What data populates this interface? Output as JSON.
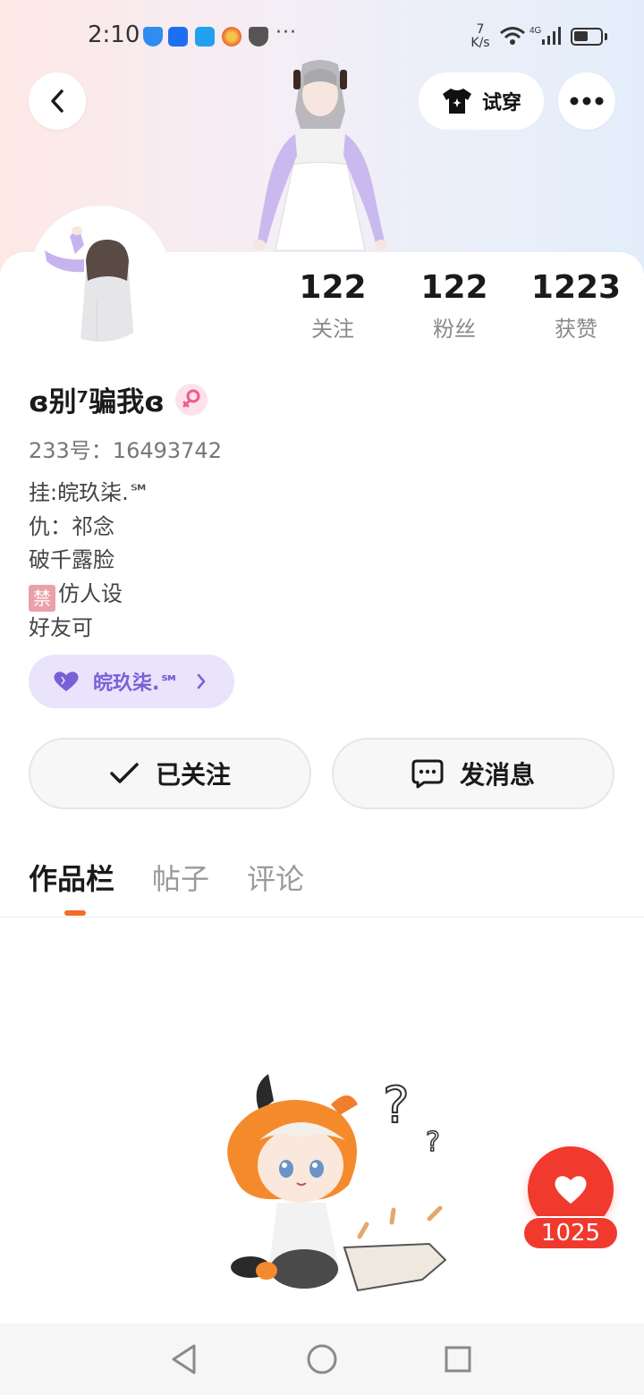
{
  "status_bar": {
    "time": "2:10",
    "more": "···",
    "net_speed_value": "7",
    "net_speed_unit": "K/s",
    "network_type": "4G",
    "battery_level": 0.55
  },
  "header": {
    "tryon_label": "试穿",
    "back_icon": "chevron-left-icon",
    "more_icon": "more-dots-icon",
    "tryon_icon": "tshirt-icon"
  },
  "stats": [
    {
      "value": "122",
      "label": "关注"
    },
    {
      "value": "122",
      "label": "粉丝"
    },
    {
      "value": "1223",
      "label": "获赞"
    }
  ],
  "profile": {
    "username": "ɞ别⁷骗我ɞ",
    "gender": "female",
    "uid": "233号：16493742",
    "bio_lines": [
      "挂:皖玖柒.℠",
      "仇：祁念",
      "破千露脸",
      "仿人设",
      "好友可"
    ],
    "ban_mark": "禁"
  },
  "group_chip": {
    "label": "皖玖柒.℠",
    "icon": "heart-icon"
  },
  "actions": {
    "follow_label": "已关注",
    "message_label": "发消息"
  },
  "tabs": [
    {
      "label": "作品栏",
      "active": true
    },
    {
      "label": "帖子",
      "active": false
    },
    {
      "label": "评论",
      "active": false
    }
  ],
  "like_fab": {
    "count": "1025"
  },
  "colors": {
    "accent_orange": "#f36c2a",
    "like_red": "#f03a2e",
    "chip_purple": "#7761d9"
  }
}
